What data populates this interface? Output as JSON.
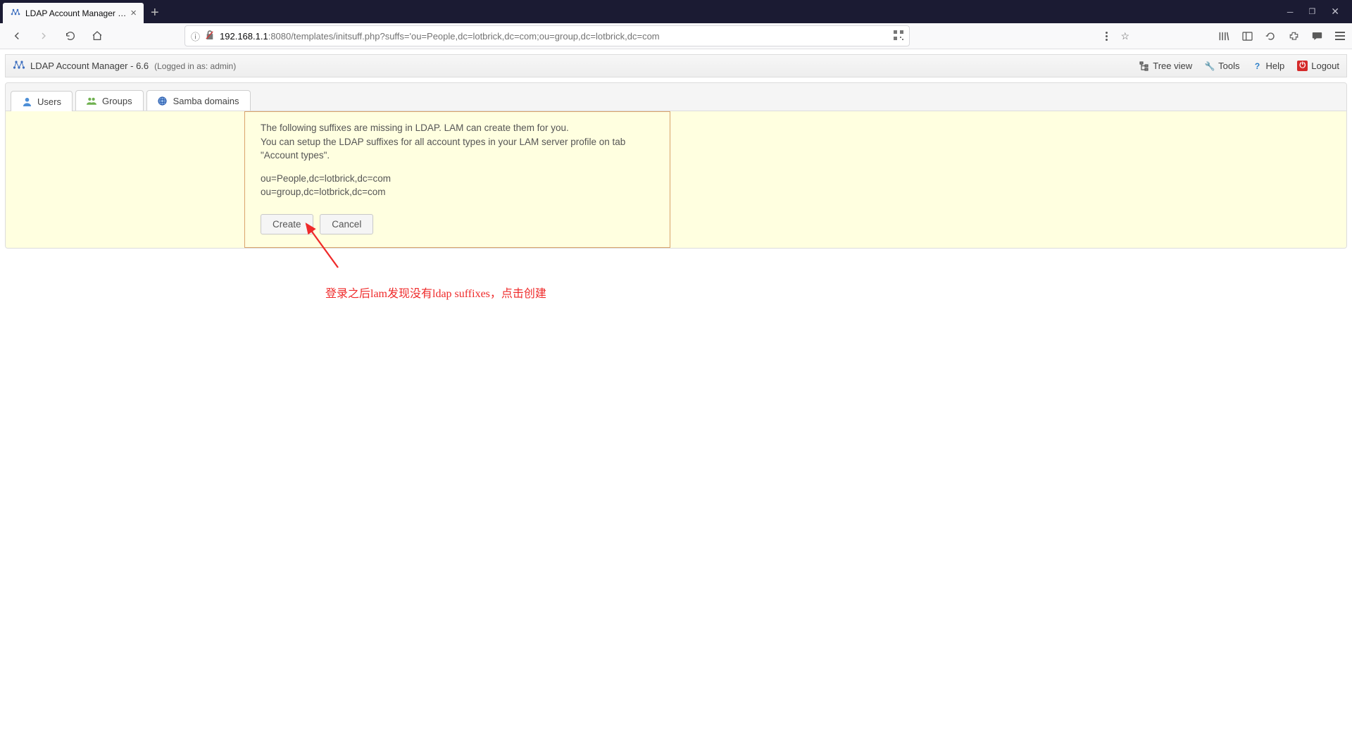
{
  "browser": {
    "tab_title": "LDAP Account Manager (ope",
    "url_host": "192.168.1.1",
    "url_rest": ":8080/templates/initsuff.php?suffs='ou=People,dc=lotbrick,dc=com;ou=group,dc=lotbrick,dc=com"
  },
  "header": {
    "title": "LDAP Account Manager - 6.6",
    "login_as": "(Logged in as: admin)",
    "links": {
      "tree": "Tree view",
      "tools": "Tools",
      "help": "Help",
      "logout": "Logout"
    }
  },
  "tabs": {
    "users": "Users",
    "groups": "Groups",
    "samba": "Samba domains"
  },
  "message": {
    "line1": "The following suffixes are missing in LDAP. LAM can create them for you.",
    "line2": "You can setup the LDAP suffixes for all account types in your LAM server profile on tab \"Account types\".",
    "suffix1": "ou=People,dc=lotbrick,dc=com",
    "suffix2": "ou=group,dc=lotbrick,dc=com",
    "create": "Create",
    "cancel": "Cancel"
  },
  "annotation": "登录之后lam发现没有ldap suffixes，点击创建"
}
